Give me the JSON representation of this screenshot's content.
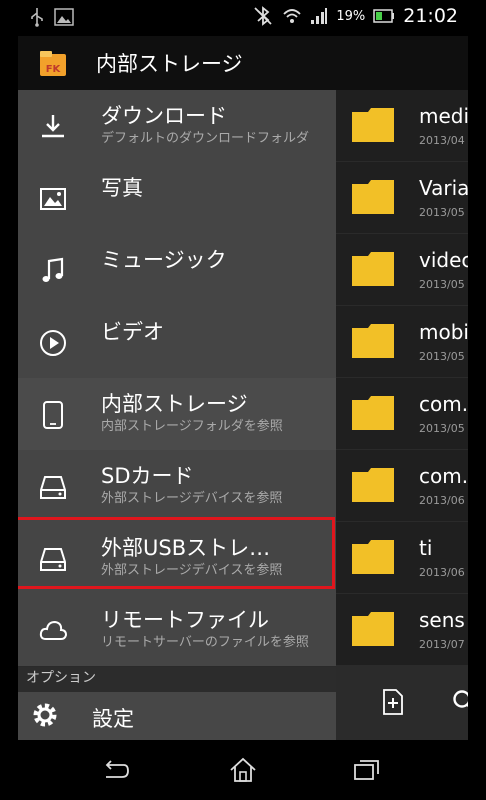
{
  "status": {
    "battery_pct": "19%",
    "time": "21:02"
  },
  "header": {
    "title": "内部ストレージ",
    "app_icon_text": "FK"
  },
  "drawer": {
    "items": [
      {
        "title": "ダウンロード",
        "subtitle": "デフォルトのダウンロードフォルダ",
        "icon": "download-icon"
      },
      {
        "title": "写真",
        "subtitle": "",
        "icon": "image-icon"
      },
      {
        "title": "ミュージック",
        "subtitle": "",
        "icon": "music-note-icon"
      },
      {
        "title": "ビデオ",
        "subtitle": "",
        "icon": "play-icon"
      },
      {
        "title": "内部ストレージ",
        "subtitle": "内部ストレージフォルダを参照",
        "icon": "tablet-icon"
      },
      {
        "title": "SDカード",
        "subtitle": "外部ストレージデバイスを参照",
        "icon": "drive-icon"
      },
      {
        "title": "外部USBストレ…",
        "subtitle": "外部ストレージデバイスを参照",
        "icon": "drive-icon"
      },
      {
        "title": "リモートファイル",
        "subtitle": "リモートサーバーのファイルを参照",
        "icon": "cloud-icon"
      }
    ],
    "section_label": "オプション",
    "settings_label": "設定"
  },
  "files": [
    {
      "name": "medi",
      "date": "2013/04"
    },
    {
      "name": "Varia",
      "date": "2013/05"
    },
    {
      "name": "videc",
      "date": "2013/05"
    },
    {
      "name": "mobi",
      "date": "2013/05"
    },
    {
      "name": "com.",
      "date": "2013/05"
    },
    {
      "name": "com.",
      "date": "2013/06"
    },
    {
      "name": "ti",
      "date": "2013/06"
    },
    {
      "name": "sens",
      "date": "2013/07"
    }
  ],
  "colors": {
    "folder": "#f2c027",
    "highlight": "#e0161d",
    "drawer_bg": "#454545"
  }
}
